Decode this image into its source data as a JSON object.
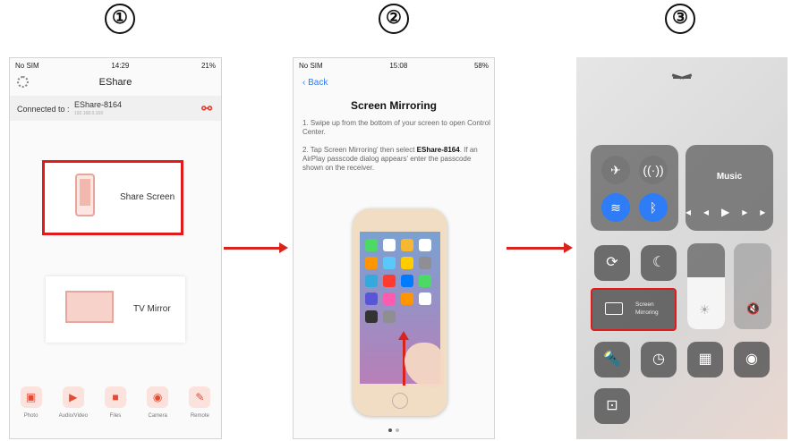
{
  "steps": [
    "①",
    "②",
    "③"
  ],
  "panel1": {
    "status": {
      "carrier": "No SIM",
      "time": "14:29",
      "battery": "21%"
    },
    "app_title": "EShare",
    "connected_label": "Connected to :",
    "device_name": "EShare-8164",
    "device_ip": "192.168.0.169",
    "share_screen_label": "Share Screen",
    "tv_mirror_label": "TV Mirror",
    "dock": [
      {
        "label": "Photo",
        "icon": "photo-icon"
      },
      {
        "label": "Audio/Video",
        "icon": "video-icon"
      },
      {
        "label": "Files",
        "icon": "folder-icon"
      },
      {
        "label": "Camera",
        "icon": "camera-icon"
      },
      {
        "label": "Remote",
        "icon": "remote-icon"
      }
    ]
  },
  "panel2": {
    "status": {
      "carrier": "No SIM",
      "time": "15:08",
      "battery": "58%"
    },
    "back_label": "Back",
    "title": "Screen Mirroring",
    "step1": "1. Swipe up from the bottom of your screen to open Control Center.",
    "step2_prefix": "2. Tap Screen Mirroring' then select ",
    "step2_device": "EShare-8164",
    "step2_suffix": ". If an AirPlay passcode dialog appears' enter the passcode shown on the receiver.",
    "page_indicator": {
      "current": 1,
      "total": 2
    }
  },
  "panel3": {
    "music_label": "Music",
    "screen_mirroring_label": "Screen Mirroring",
    "brightness_level": 0.6
  },
  "colors": {
    "accent_red": "#e11b1b",
    "ios_blue": "#2e7cf6"
  }
}
